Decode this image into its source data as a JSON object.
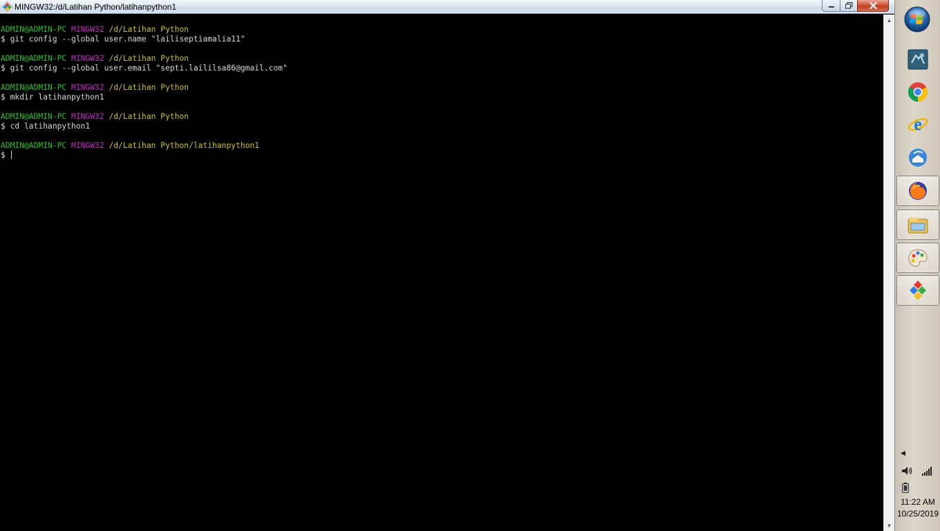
{
  "window": {
    "title": "MINGW32:/d/Latihan Python/latihanpython1"
  },
  "terminal": {
    "lines": [
      {
        "kind": "prompt",
        "user": "ADMIN@ADMIN-PC",
        "system": "MINGW32",
        "path": "/d/Latihan Python"
      },
      {
        "kind": "cmd",
        "text": "$ git config --global user.name \"lailiseptiamalia11\""
      },
      {
        "kind": "blank"
      },
      {
        "kind": "prompt",
        "user": "ADMIN@ADMIN-PC",
        "system": "MINGW32",
        "path": "/d/Latihan Python"
      },
      {
        "kind": "cmd",
        "text": "$ git config --global user.email \"septi.laililsa86@gmail.com\""
      },
      {
        "kind": "blank"
      },
      {
        "kind": "prompt",
        "user": "ADMIN@ADMIN-PC",
        "system": "MINGW32",
        "path": "/d/Latihan Python"
      },
      {
        "kind": "cmd",
        "text": "$ mkdir latihanpython1"
      },
      {
        "kind": "blank"
      },
      {
        "kind": "prompt",
        "user": "ADMIN@ADMIN-PC",
        "system": "MINGW32",
        "path": "/d/Latihan Python"
      },
      {
        "kind": "cmd",
        "text": "$ cd latihanpython1"
      },
      {
        "kind": "blank"
      },
      {
        "kind": "prompt",
        "user": "ADMIN@ADMIN-PC",
        "system": "MINGW32",
        "path": "/d/Latihan Python/latihanpython1"
      },
      {
        "kind": "input",
        "text": "$ "
      }
    ],
    "colors": {
      "user": "#2bc02b",
      "system": "#c22dc2",
      "path": "#c9c22b",
      "text": "#d9d9d9",
      "background": "#000000"
    }
  },
  "taskbar": {
    "items": [
      {
        "name": "git-bash-icon",
        "active": false
      },
      {
        "name": "chrome-icon",
        "active": false
      },
      {
        "name": "internet-explorer-icon",
        "active": false
      },
      {
        "name": "thunderbird-icon",
        "active": false
      },
      {
        "name": "firefox-icon",
        "active": true
      },
      {
        "name": "file-explorer-icon",
        "active": true
      },
      {
        "name": "paint-icon",
        "active": true
      },
      {
        "name": "app-diamond-icon",
        "active": true
      }
    ],
    "clock": {
      "time": "11:22 AM",
      "date": "10/25/2019"
    }
  }
}
